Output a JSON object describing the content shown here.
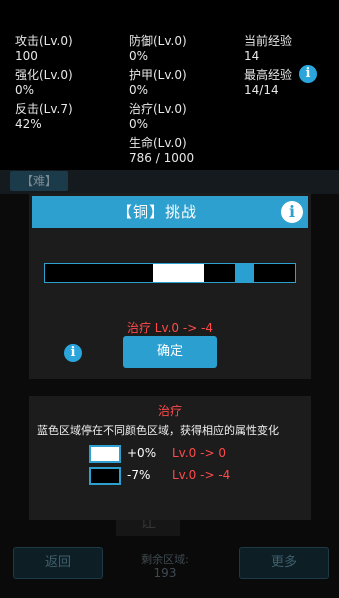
{
  "stats": {
    "attack": {
      "label": "攻击(Lv.0)",
      "value": "100"
    },
    "defense": {
      "label": "防御(Lv.0)",
      "value": "0%"
    },
    "current_exp": {
      "label": "当前经验",
      "value": "14"
    },
    "enhance": {
      "label": "强化(Lv.0)",
      "value": "0%"
    },
    "armor": {
      "label": "护甲(Lv.0)",
      "value": "0%"
    },
    "max_exp": {
      "label": "最高经验",
      "value": "14/14"
    },
    "counter": {
      "label": "反击(Lv.7)",
      "value": "42%"
    },
    "heal": {
      "label": "治疗(Lv.0)",
      "value": "0%"
    },
    "life": {
      "label": "生命(Lv.0)",
      "value": "786 / 1000"
    }
  },
  "difficulty_tab": "【难】",
  "modal": {
    "title": "【铜】挑战",
    "bar_zones": [
      {
        "start": 0,
        "end": 0.43,
        "color": "#000000"
      },
      {
        "start": 0.43,
        "end": 0.635,
        "color": "#ffffff"
      },
      {
        "start": 0.635,
        "end": 0.76,
        "color": "#000000"
      },
      {
        "start": 0.76,
        "end": 0.835,
        "color": "#2aa0d2"
      },
      {
        "start": 0.835,
        "end": 1,
        "color": "#000000"
      }
    ],
    "effect": "治疗  Lv.0 -> -4",
    "confirm_label": "确定"
  },
  "panel": {
    "title": "治疗",
    "description": "蓝色区域停在不同颜色区域，获得相应的属性变化",
    "legend": [
      {
        "color": "#ffffff",
        "percent": "+0%",
        "level": "Lv.0 -> 0"
      },
      {
        "color": "#000000",
        "percent": "-7%",
        "level": "Lv.0 -> -4"
      }
    ]
  },
  "background": {
    "back_label": "返回",
    "more_label": "更多",
    "remaining_label": "剩余区域:",
    "remaining_value": "193",
    "tile_label": "让"
  },
  "colors": {
    "accent": "#2ea0cf",
    "red": "#ff4a4a",
    "panel_bg": "#1c1c1c"
  },
  "icons": [
    "info-icon"
  ]
}
